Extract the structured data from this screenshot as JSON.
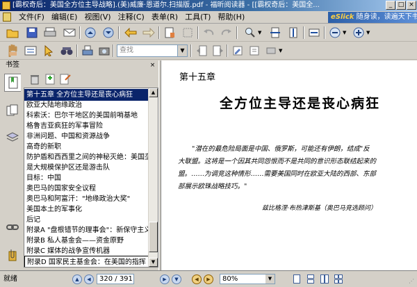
{
  "window": {
    "title": "[霸权奇后：美国全方位主导战略].(美)威廉·恩道尔.扫描版.pdf - 福昕阅读器 - [[霸权奇后：美国全..."
  },
  "menu": {
    "items": [
      "文件(F)",
      "编辑(E)",
      "视图(V)",
      "注释(C)",
      "表单(R)",
      "工具(T)",
      "帮助(H)"
    ]
  },
  "brand": {
    "logo": "eSlick",
    "slogan": "随身读，读遍天下书！"
  },
  "search": {
    "placeholder": "查找"
  },
  "sidebar": {
    "title": "书签",
    "bookmarks": [
      "第十五章 全方位主导还是丧心病狂",
      "欧亚大陆地缘政治",
      "科索沃：巴尔干地区的美国前哨基地",
      "格鲁吉亚疯狂的军事冒险",
      "非洲问题、中国和资源战争",
      "高奇的新职",
      "防护盾和西西里之间的神秘灭绝：美国垄断",
      "是大规模保护区还是游击队",
      "目标：中国",
      "奥巴马的国家安全议程",
      "奥巴马和阿富汗：\"地缘政治大奖\"",
      "美国本土的军事化",
      "后记",
      "附录A \"盘根错节的理事会\"：新保守主义",
      "附录B 私人基金会——资金原野",
      "附录C 媒体的战争宣传机器",
      "附录D 国家民主基金会：在美国的指挥"
    ],
    "selected_index": 0
  },
  "page": {
    "chapter": "第十五章",
    "title": "全方位主导还是丧心病狂",
    "quote_lines": [
      "\"潜在的最危险局面是中国、俄罗斯，可能还有伊朗，结成\"反",
      "大联盟。这将是一个因其共同怨恨而不是共同的意识形态联结起来的",
      "盟。……为调竞这种情形……需要美国同时在欧亚大陆的西部、东部",
      "部展示欧珠战略技巧。\""
    ],
    "attribution": "兹比格涅·布热津斯基（奥巴马竞选顾问）"
  },
  "status": {
    "text": "就绪",
    "current_page": "320 / 391",
    "zoom": "80%"
  }
}
